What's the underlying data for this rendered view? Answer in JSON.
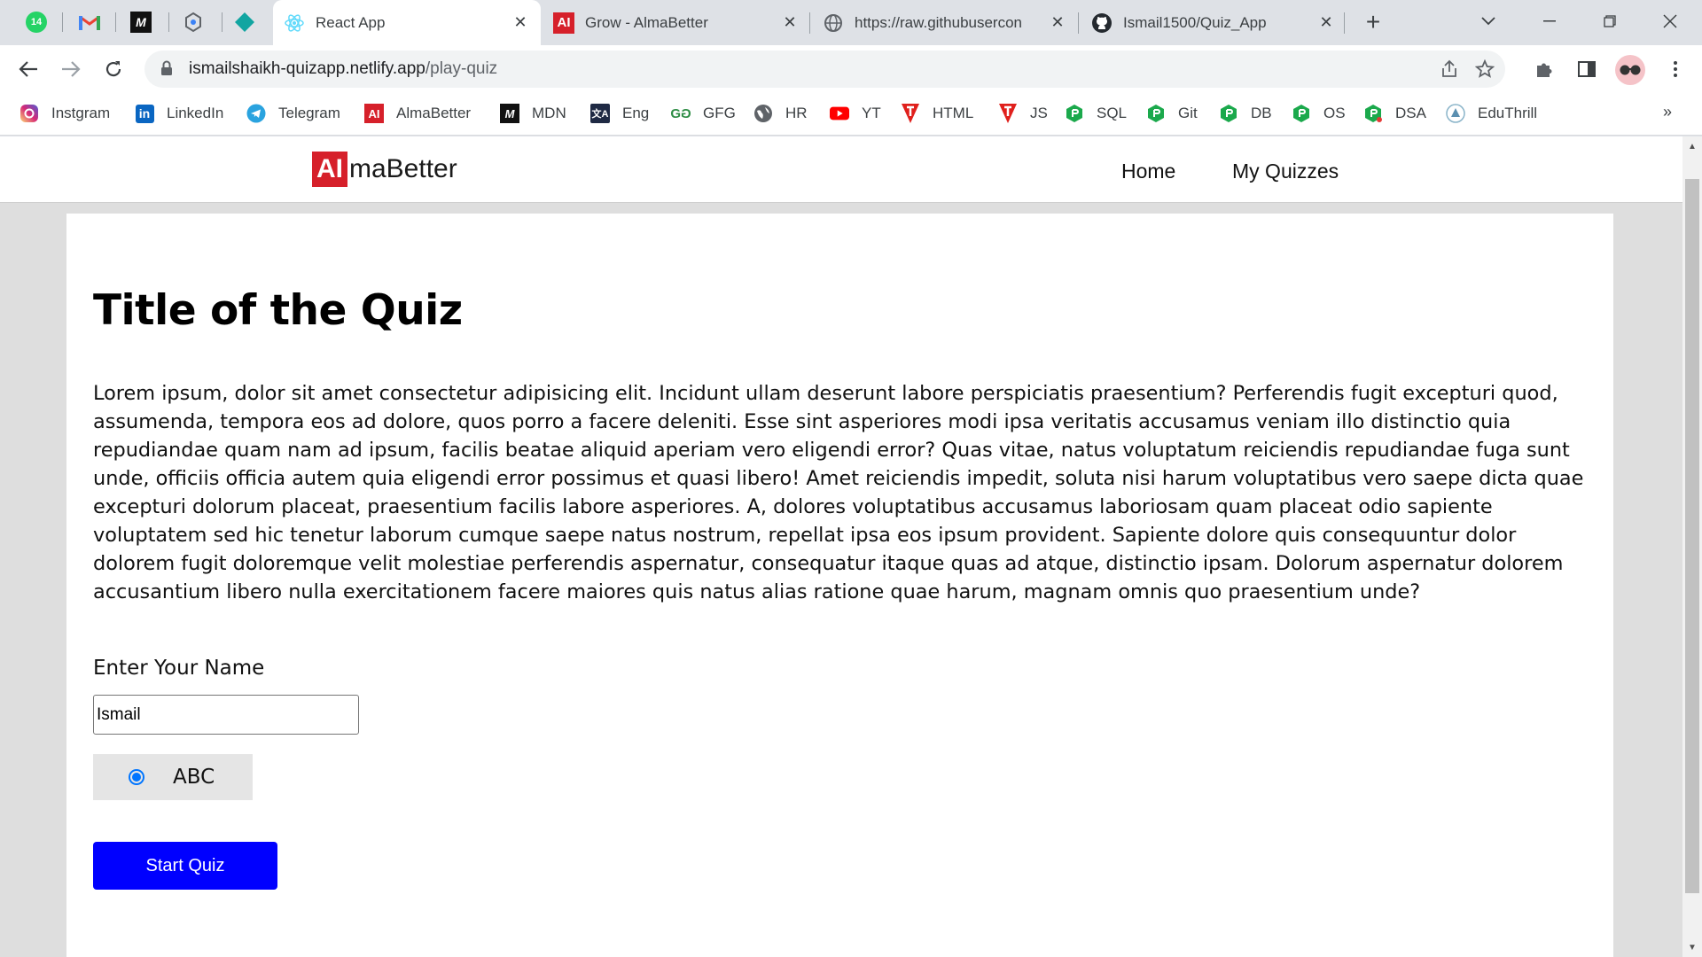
{
  "browser": {
    "pinned_tabs": [
      {
        "icon": "whatsapp-icon",
        "badge": "14"
      },
      {
        "icon": "gmail-icon"
      },
      {
        "icon": "mdn-icon"
      },
      {
        "icon": "react-dev-icon"
      },
      {
        "icon": "diamond-app-icon"
      }
    ],
    "tabs": [
      {
        "title": "React App",
        "icon": "react-icon",
        "active": true
      },
      {
        "title": "Grow - AlmaBetter",
        "icon": "almabetter-icon",
        "active": false
      },
      {
        "title": "https://raw.githubusercon",
        "icon": "globe-icon",
        "active": false
      },
      {
        "title": "Ismail1500/Quiz_App",
        "icon": "github-icon",
        "active": false
      }
    ],
    "close_glyph": "✕",
    "new_tab_glyph": "+",
    "address": {
      "host": "ismailshaikh-quizapp.netlify.app",
      "path": "/play-quiz"
    },
    "bookmarks": [
      {
        "label": "Instgram",
        "icon": "instagram-icon"
      },
      {
        "label": "LinkedIn",
        "icon": "linkedin-icon"
      },
      {
        "label": "Telegram",
        "icon": "telegram-icon"
      },
      {
        "label": "AlmaBetter",
        "icon": "almabetter-icon"
      },
      {
        "label": "MDN",
        "icon": "mdn-icon"
      },
      {
        "label": "Eng",
        "icon": "translate-icon"
      },
      {
        "label": "GFG",
        "icon": "gfg-icon"
      },
      {
        "label": "HR",
        "icon": "globe-icon"
      },
      {
        "label": "YT",
        "icon": "youtube-icon"
      },
      {
        "label": "HTML",
        "icon": "tutorial-icon"
      },
      {
        "label": "JS",
        "icon": "tutorial-icon"
      },
      {
        "label": "SQL",
        "icon": "hex-icon"
      },
      {
        "label": "Git",
        "icon": "hex-icon"
      },
      {
        "label": "DB",
        "icon": "hex-icon"
      },
      {
        "label": "OS",
        "icon": "hex-icon"
      },
      {
        "label": "DSA",
        "icon": "hex-icon"
      },
      {
        "label": "EduThrill",
        "icon": "eduthrill-icon"
      }
    ],
    "bookmarks_more": "»"
  },
  "site": {
    "logo_mark": "AI",
    "logo_text": "maBetter",
    "nav": [
      "Home",
      "My Quizzes"
    ]
  },
  "quiz": {
    "title": "Title of the Quiz",
    "description": "Lorem ipsum, dolor sit amet consectetur adipisicing elit. Incidunt ullam deserunt labore perspiciatis praesentium? Perferendis fugit excepturi quod, assumenda, tempora eos ad dolore, quos porro a facere deleniti. Esse sint asperiores modi ipsa veritatis accusamus veniam illo distinctio quia repudiandae quam nam ad ipsum, facilis beatae aliquid aperiam vero eligendi error? Quas vitae, natus voluptatum reiciendis repudiandae fuga sunt unde, officiis officia autem quia eligendi error possimus et quasi libero! Amet reiciendis impedit, soluta nisi harum voluptatibus vero saepe dicta quae excepturi dolorum placeat, praesentium facilis labore asperiores. A, dolores voluptatibus accusamus laboriosam quam placeat odio sapiente voluptatem sed hic tenetur laborum cumque saepe natus nostrum, repellat ipsa eos ipsum provident. Sapiente dolore quis consequuntur dolor dolorem fugit doloremque velit molestiae perferendis aspernatur, consequatur itaque quas ad atque, distinctio ipsam. Dolorum aspernatur dolorem accusantium libero nulla exercitationem facere maiores quis natus alias ratione quae harum, magnam omnis quo praesentium unde?",
    "name_label": "Enter Your Name",
    "name_value": "Ismail",
    "option_label": "ABC",
    "option_selected": true,
    "start_button": "Start Quiz"
  },
  "colors": {
    "brand_red": "#d6202a",
    "start_button": "#0000ff",
    "radio_accent": "#0075ff"
  }
}
